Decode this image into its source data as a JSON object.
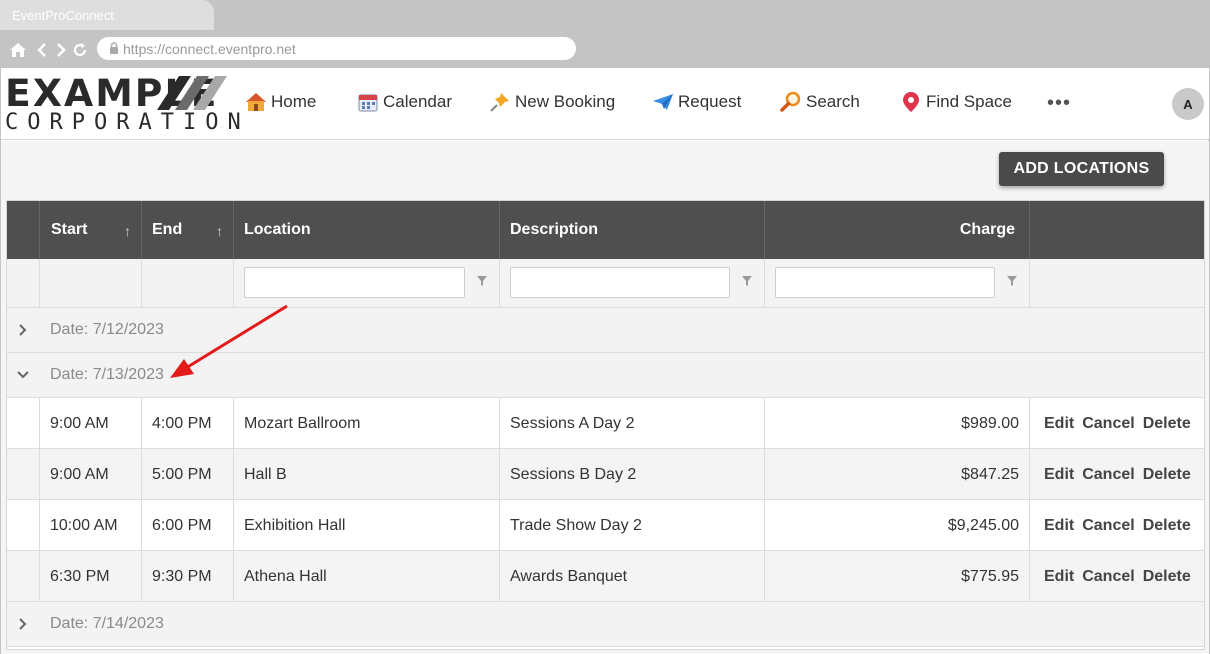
{
  "browser": {
    "tab_title": "EventProConnect",
    "url": "https://connect.eventpro.net"
  },
  "logo": {
    "line1": "EXAMPLE",
    "line2": "CORPORATION"
  },
  "nav": {
    "home": "Home",
    "calendar": "Calendar",
    "new_booking": "New Booking",
    "request": "Request",
    "search": "Search",
    "find_space": "Find Space",
    "more": "•••",
    "avatar_initial": "A"
  },
  "actions": {
    "add_locations": "ADD LOCATIONS"
  },
  "grid": {
    "columns": {
      "start": "Start",
      "end": "End",
      "location": "Location",
      "description": "Description",
      "charge": "Charge"
    },
    "sort_glyph": "↑",
    "groups": [
      {
        "label": "Date: 7/12/2023",
        "expanded": false
      },
      {
        "label": "Date: 7/13/2023",
        "expanded": true
      },
      {
        "label": "Date: 7/14/2023",
        "expanded": false
      }
    ],
    "rows": [
      {
        "start": "9:00 AM",
        "end": "4:00 PM",
        "location": "Mozart Ballroom",
        "description": "Sessions A Day 2",
        "charge": "$989.00"
      },
      {
        "start": "9:00 AM",
        "end": "5:00 PM",
        "location": "Hall B",
        "description": "Sessions B Day 2",
        "charge": "$847.25"
      },
      {
        "start": "10:00 AM",
        "end": "6:00 PM",
        "location": "Exhibition Hall",
        "description": "Trade Show Day 2",
        "charge": "$9,245.00"
      },
      {
        "start": "6:30 PM",
        "end": "9:30 PM",
        "location": "Athena Hall",
        "description": "Awards Banquet",
        "charge": "$775.95"
      }
    ],
    "row_actions": {
      "edit": "Edit",
      "cancel": "Cancel",
      "delete": "Delete"
    }
  },
  "colors": {
    "header_bg": "#4f4f4f",
    "button_bg": "#4a4a4a",
    "annotation_arrow": "#e31b1b"
  }
}
